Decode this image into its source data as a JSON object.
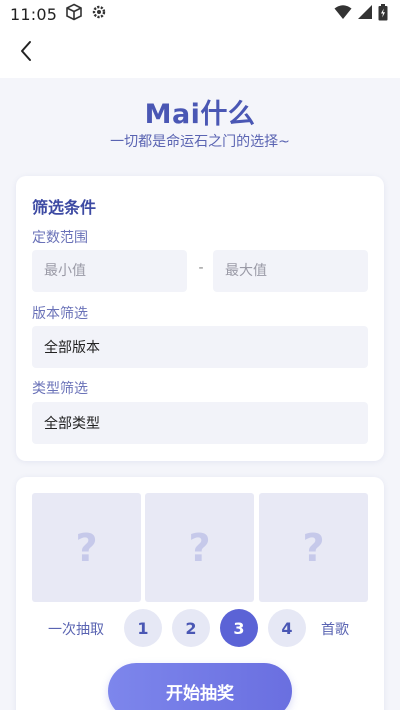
{
  "status_bar": {
    "time": "11:05",
    "icons": [
      "cube-icon",
      "gear-icon",
      "wifi-icon",
      "signal-icon",
      "battery-icon"
    ]
  },
  "header": {
    "back_icon": "back-arrow-icon",
    "title": "Mai什么",
    "subtitle": "一切都是命运石之门的选择~"
  },
  "filter": {
    "title": "筛选条件",
    "level_range": {
      "label": "定数范围",
      "min_placeholder": "最小值",
      "separator": "-",
      "max_placeholder": "最大值"
    },
    "version": {
      "label": "版本筛选",
      "selected": "全部版本"
    },
    "type": {
      "label": "类型筛选",
      "selected": "全部类型"
    }
  },
  "draw": {
    "slots": [
      "?",
      "?",
      "?"
    ],
    "count_label": "一次抽取",
    "counts": [
      "1",
      "2",
      "3",
      "4"
    ],
    "selected_count": "3",
    "unit_label": "首歌",
    "start_label": "开始抽奖"
  },
  "colors": {
    "accent": "#4a57b4",
    "active": "#5b63d6",
    "button_gradient_start": "#7d86ec",
    "button_gradient_end": "#6a6fe0"
  }
}
